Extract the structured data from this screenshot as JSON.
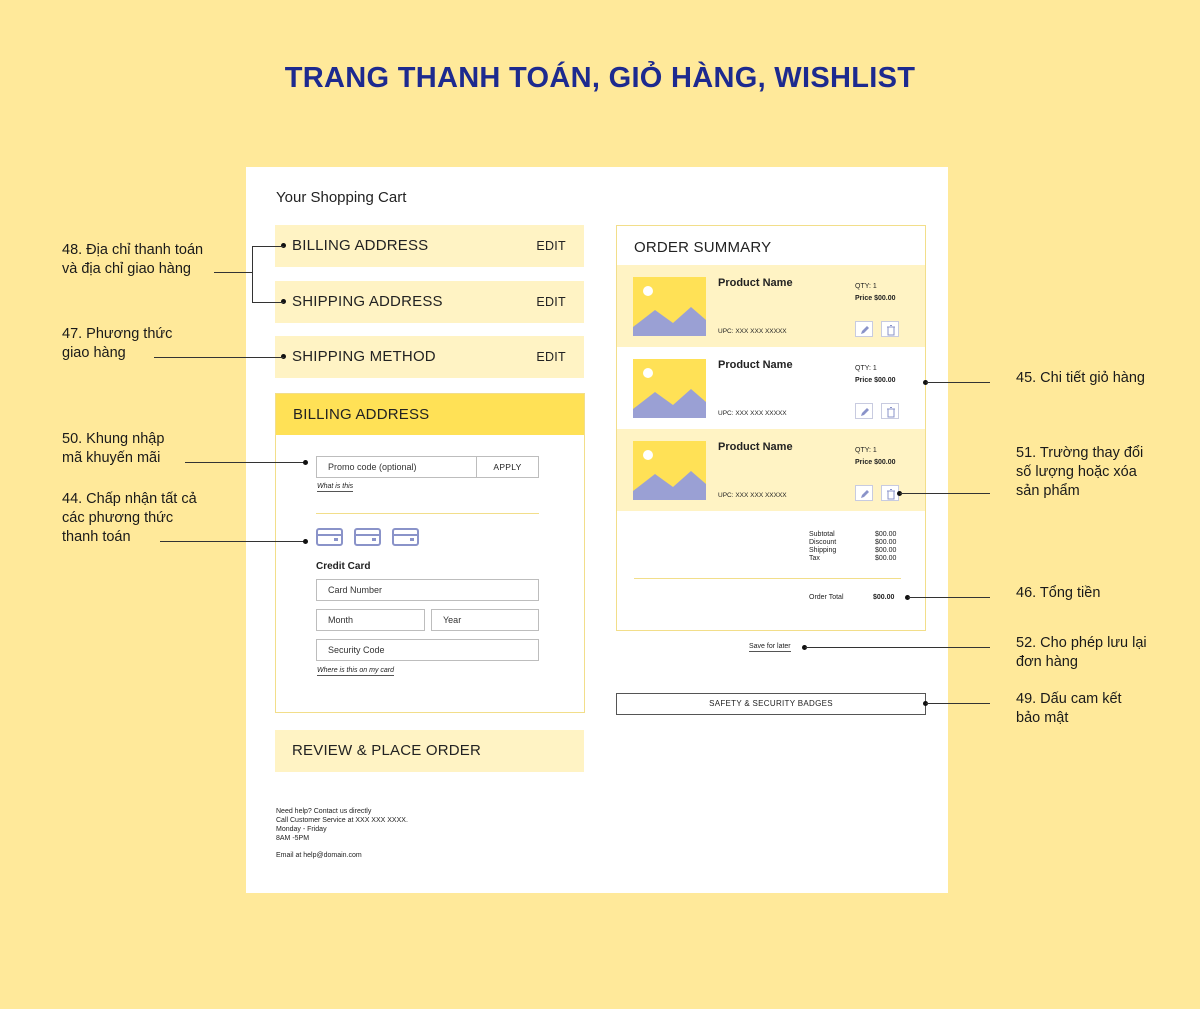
{
  "page_title": "TRANG THANH TOÁN, GIỎ HÀNG, WISHLIST",
  "cart": {
    "title": "Your Shopping Cart",
    "sections": [
      {
        "label": "BILLING ADDRESS",
        "edit": "EDIT"
      },
      {
        "label": "SHIPPING ADDRESS",
        "edit": "EDIT"
      },
      {
        "label": "SHIPPING METHOD",
        "edit": "EDIT"
      }
    ],
    "billing": {
      "header": "BILLING ADDRESS",
      "promo_placeholder": "Promo code (optional)",
      "apply_label": "APPLY",
      "what_is_this": "What is this",
      "credit_card_title": "Credit Card",
      "card_number": "Card Number",
      "month": "Month",
      "year": "Year",
      "security_code": "Security Code",
      "where_on_card": "Where is this on my card"
    },
    "review_label": "REVIEW & PLACE ORDER",
    "help": [
      "Need help? Contact us directly",
      "Call Customer Service at XXX XXX XXXX.",
      "Monday - Friday",
      "8AM -5PM",
      "",
      "Email at help@domain.com"
    ]
  },
  "summary": {
    "title": "ORDER SUMMARY",
    "items": [
      {
        "name": "Product Name",
        "qty": "QTY: 1",
        "price": "Price $00.00",
        "upc": "UPC: XXX XXX XXXXX"
      },
      {
        "name": "Product Name",
        "qty": "QTY: 1",
        "price": "Price $00.00",
        "upc": "UPC: XXX XXX XXXXX"
      },
      {
        "name": "Product Name",
        "qty": "QTY: 1",
        "price": "Price $00.00",
        "upc": "UPC: XXX XXX XXXXX"
      }
    ],
    "totals_labels": [
      "Subtotal",
      "Discount",
      "Shipping",
      "Tax"
    ],
    "totals_values": [
      "$00.00",
      "$00.00",
      "$00.00",
      "$00.00"
    ],
    "order_total_label": "Order Total",
    "order_total_value": "$00.00",
    "save_for_later": "Save for later",
    "badges_label": "SAFETY & SECURITY BADGES"
  },
  "annotations": {
    "a48": [
      "48. Địa chỉ thanh toán",
      "và địa chỉ giao hàng"
    ],
    "a47": [
      "47. Phương thức",
      "giao hàng"
    ],
    "a50": [
      "50. Khung nhập",
      "mã khuyến mãi"
    ],
    "a44": [
      "44. Chấp nhận tất cả",
      "các phương thức",
      "thanh toán"
    ],
    "a45": [
      "45. Chi tiết giỏ hàng"
    ],
    "a51": [
      "51. Trường thay đổi",
      "số lượng hoặc xóa",
      "sản phẩm"
    ],
    "a46": [
      "46. Tổng tiền"
    ],
    "a52": [
      "52. Cho phép lưu lại",
      "đơn hàng"
    ],
    "a49": [
      "49. Dấu cam kết",
      "bảo mật"
    ]
  },
  "colors": {
    "background": "#ffe99a",
    "title": "#1d2a8f",
    "row_fill": "#fff3c4",
    "accent_yellow": "#ffe156",
    "icon_blue": "#8a93c9"
  }
}
